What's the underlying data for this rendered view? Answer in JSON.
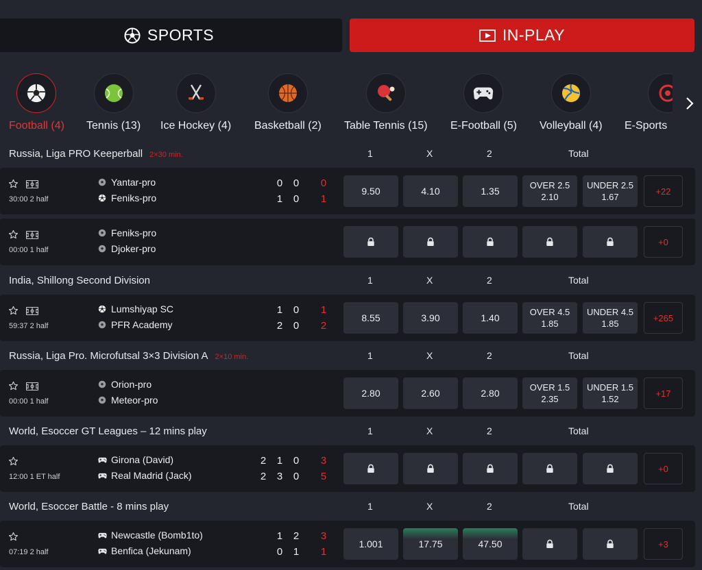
{
  "tabs": {
    "sports": "SPORTS",
    "inplay": "IN-PLAY"
  },
  "sports": [
    {
      "label": "Football (4)",
      "icon": "football-icon"
    },
    {
      "label": "Tennis (13)",
      "icon": "tennis-icon"
    },
    {
      "label": "Ice Hockey (4)",
      "icon": "ice-hockey-icon"
    },
    {
      "label": "Basketball (2)",
      "icon": "basketball-icon"
    },
    {
      "label": "Table Tennis (15)",
      "icon": "table-tennis-icon"
    },
    {
      "label": "E-Football (5)",
      "icon": "gamepad-icon"
    },
    {
      "label": "Volleyball (4)",
      "icon": "volleyball-icon"
    },
    {
      "label": "E-Sports",
      "icon": "esports-icon"
    }
  ],
  "headers": {
    "one": "1",
    "x": "X",
    "two": "2",
    "total": "Total"
  },
  "leagues": [
    {
      "name": "Russia, Liga PRO Keeperball",
      "duration": "2×30 min."
    },
    {
      "name": "India, Shillong Second Division",
      "duration": ""
    },
    {
      "name": "Russia, Liga Pro. Microfutsal 3×3 Division A",
      "duration": "2×10 min."
    },
    {
      "name": "World, Esoccer GT Leagues – 12 mins play",
      "duration": ""
    },
    {
      "name": "World, Esoccer Battle - 8 mins play",
      "duration": ""
    }
  ],
  "matches": [
    {
      "time": "30:00  2 half",
      "team1": "Yantar-pro",
      "team2": "Feniks-pro",
      "score1": [
        "0",
        "0",
        "0"
      ],
      "score2": [
        "1",
        "0",
        "1"
      ],
      "odds": [
        "9.50",
        "4.10",
        "1.35"
      ],
      "over": "OVER 2.5",
      "over_odd": "2.10",
      "under": "UNDER 2.5",
      "under_odd": "1.67",
      "more": "+22"
    },
    {
      "time": "00:00 1 half",
      "team1": "Feniks-pro",
      "team2": "Djoker-pro",
      "locked": true,
      "more": "+0"
    },
    {
      "time": "59:37  2 half",
      "team1": "Lumshiyap SC",
      "team2": "PFR Academy",
      "score1": [
        "1",
        "0",
        "1"
      ],
      "score2": [
        "2",
        "0",
        "2"
      ],
      "odds": [
        "8.55",
        "3.90",
        "1.40"
      ],
      "over": "OVER 4.5",
      "over_odd": "1.85",
      "under": "UNDER 4.5",
      "under_odd": "1.85",
      "more": "+265"
    },
    {
      "time": "00:00 1 half",
      "team1": "Orion-pro",
      "team2": "Meteor-pro",
      "odds": [
        "2.80",
        "2.60",
        "2.80"
      ],
      "over": "OVER 1.5",
      "over_odd": "2.35",
      "under": "UNDER 1.5",
      "under_odd": "1.52",
      "more": "+17"
    },
    {
      "time": "12:00  1 ET half",
      "team1": "Girona (David)",
      "team2": "Real Madrid (Jack)",
      "score1": [
        "2",
        "1",
        "0",
        "3"
      ],
      "score2": [
        "2",
        "3",
        "0",
        "5"
      ],
      "locked": true,
      "more": "+0"
    },
    {
      "time": "07:19  2 half",
      "team1": "Newcastle (Bomb1to)",
      "team2": "Benfica (Jekunam)",
      "score1": [
        "1",
        "2",
        "3"
      ],
      "score2": [
        "0",
        "1",
        "1"
      ],
      "odds": [
        "1.001",
        "17.75",
        "47.50"
      ],
      "more": "+3"
    }
  ],
  "colors": {
    "accent": "#cc1b1b",
    "bg": "#24262f",
    "row": "#191a20",
    "odd": "#2c2e38"
  }
}
